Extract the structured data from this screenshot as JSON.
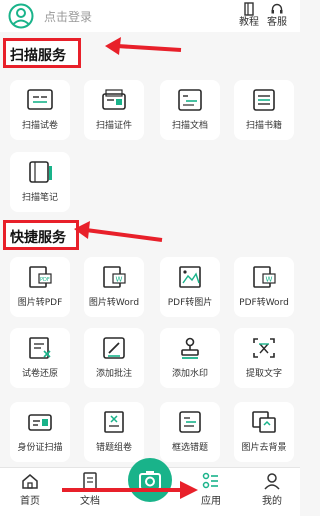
{
  "colors": {
    "accent": "#19b38a",
    "annotation": "#e8202a",
    "icon": "#2a2a2a"
  },
  "header": {
    "login_text": "点击登录",
    "tutorial_label": "教程",
    "service_label": "客服"
  },
  "sections": {
    "scan": {
      "title": "扫描服务",
      "items": [
        {
          "label": "扫描试卷",
          "icon": "exam-icon"
        },
        {
          "label": "扫描证件",
          "icon": "id-card-icon"
        },
        {
          "label": "扫描文档",
          "icon": "document-icon"
        },
        {
          "label": "扫描书籍",
          "icon": "book-icon"
        },
        {
          "label": "扫描笔记",
          "icon": "notebook-icon"
        }
      ]
    },
    "quick": {
      "title": "快捷服务",
      "items": [
        {
          "label": "图片转PDF",
          "icon": "image-to-pdf-icon"
        },
        {
          "label": "图片转Word",
          "icon": "image-to-word-icon"
        },
        {
          "label": "PDF转图片",
          "icon": "pdf-to-image-icon"
        },
        {
          "label": "PDF转Word",
          "icon": "pdf-to-word-icon"
        },
        {
          "label": "试卷还原",
          "icon": "restore-exam-icon"
        },
        {
          "label": "添加批注",
          "icon": "annotate-icon"
        },
        {
          "label": "添加水印",
          "icon": "watermark-icon"
        },
        {
          "label": "提取文字",
          "icon": "extract-text-icon"
        },
        {
          "label": "身份证扫描",
          "icon": "id-scan-icon"
        },
        {
          "label": "错题组卷",
          "icon": "wrong-questions-icon"
        },
        {
          "label": "框选错题",
          "icon": "select-wrong-icon"
        },
        {
          "label": "图片去背景",
          "icon": "remove-background-icon"
        }
      ]
    }
  },
  "bottom_nav": {
    "items": [
      {
        "label": "首页",
        "icon": "home-icon"
      },
      {
        "label": "文档",
        "icon": "document-nav-icon"
      },
      {
        "label": "",
        "icon": "camera-icon"
      },
      {
        "label": "应用",
        "icon": "apps-icon",
        "active": true
      },
      {
        "label": "我的",
        "icon": "profile-icon"
      }
    ]
  }
}
